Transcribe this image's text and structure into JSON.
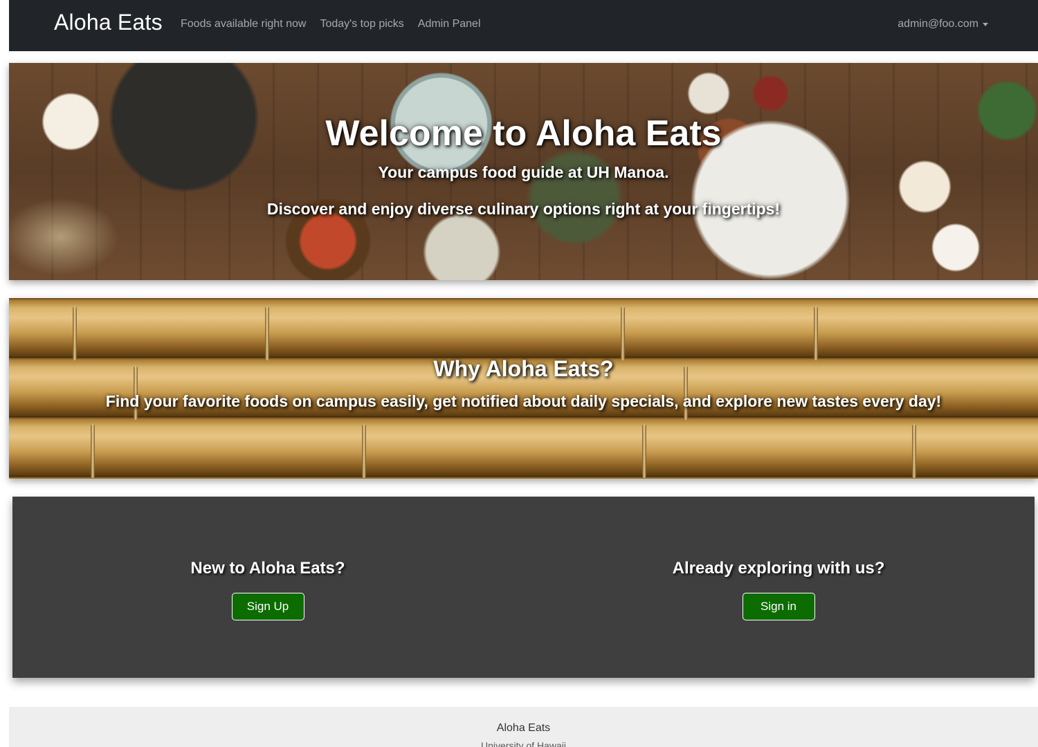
{
  "navbar": {
    "brand": "Aloha Eats",
    "links": [
      {
        "label": "Foods available right now"
      },
      {
        "label": "Today's top picks"
      },
      {
        "label": "Admin Panel"
      }
    ],
    "user": "admin@foo.com"
  },
  "hero": {
    "title": "Welcome to Aloha Eats",
    "subtitle": "Your campus food guide at UH Manoa.",
    "tagline": "Discover and enjoy diverse culinary options right at your fingertips!"
  },
  "why": {
    "title": "Why Aloha Eats?",
    "text": "Find your favorite foods on campus easily, get notified about daily specials, and explore new tastes every day!"
  },
  "cta": {
    "new_heading": "New to Aloha Eats?",
    "signup_label": "Sign Up",
    "existing_heading": "Already exploring with us?",
    "signin_label": "Sign in"
  },
  "footer": {
    "title": "Aloha Eats",
    "subtitle": "University of Hawaii"
  },
  "colors": {
    "navbar_bg": "#212529",
    "panel_bg": "#3f3f3f",
    "button_green": "#0c6c00",
    "footer_bg": "#eeeeee"
  }
}
